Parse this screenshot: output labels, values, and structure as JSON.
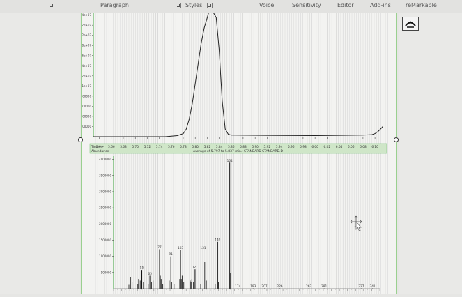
{
  "ribbon": {
    "paragraph_label": "Paragraph",
    "styles_label": "Styles",
    "tabs": [
      {
        "label": "Voice"
      },
      {
        "label": "Sensitivity"
      },
      {
        "label": "Editor"
      },
      {
        "label": "Add-ins"
      },
      {
        "label": "reMarkable"
      }
    ]
  },
  "chromatogram": {
    "y_ticks": [
      "2.4e+07",
      "2.2e+07",
      "2e+07",
      "1.8e+07",
      "1.6e+07",
      "1.4e+07",
      "1.2e+07",
      "1e+07",
      "8000000",
      "6000000",
      "4000000",
      "2000000"
    ],
    "time_label": "Time-->",
    "x_ticks": [
      "5.64",
      "5.66",
      "5.68",
      "5.70",
      "5.72",
      "5.74",
      "5.76",
      "5.78",
      "5.80",
      "5.82",
      "5.84",
      "5.86",
      "5.88",
      "5.90",
      "5.92",
      "5.94",
      "5.96",
      "5.98",
      "6.00",
      "6.02",
      "6.04",
      "6.06",
      "6.08",
      "6.10"
    ]
  },
  "spectrum": {
    "abundance_label": "Abundance",
    "caption": "Average of 5.797 to 5.837 min.: STANDARD STANDARD.D",
    "y_ticks": [
      "4000000",
      "3500000",
      "3000000",
      "2500000",
      "2000000",
      "1500000",
      "1000000",
      "500000"
    ],
    "peak_labels": [
      "164",
      "149",
      "131",
      "103",
      "91",
      "77",
      "121",
      "55",
      "65",
      "174",
      "193",
      "207",
      "226",
      "262",
      "281",
      "327",
      "341"
    ]
  },
  "chart_data": [
    {
      "type": "line",
      "title": "",
      "xlabel": "Time-->",
      "ylabel": "",
      "xlim": [
        5.63,
        6.115
      ],
      "ylim": [
        0,
        24500000
      ],
      "grid": false,
      "legend": "none",
      "series": [
        {
          "x": [
            5.63,
            5.75,
            5.77,
            5.78,
            5.785,
            5.79,
            5.795,
            5.8,
            5.805,
            5.81,
            5.815,
            5.82,
            5.8235,
            5.828,
            5.835,
            5.84,
            5.845,
            5.85,
            5.855,
            5.86,
            6.0,
            6.08,
            6.095,
            6.1,
            6.105,
            6.11,
            6.113
          ],
          "y": [
            0,
            0,
            200000,
            600000,
            1500000,
            3500000,
            6500000,
            10500000,
            14500000,
            18500000,
            21500000,
            23500000,
            25000000,
            25000000,
            23500000,
            17000000,
            7000000,
            1500000,
            500000,
            300000,
            200000,
            300000,
            400000,
            600000,
            1000000,
            1600000,
            2000000
          ]
        }
      ]
    },
    {
      "type": "bar",
      "title": "Average of 5.797 to 5.837 min.: STANDARD STANDARD.D",
      "xlabel": "",
      "ylabel": "Abundance",
      "xlim": [
        20,
        350
      ],
      "ylim": [
        0,
        4100000
      ],
      "grid": false,
      "legend": "none",
      "labeled_peaks": [
        {
          "mz": 55,
          "abundance": 580000
        },
        {
          "mz": 65,
          "abundance": 400000
        },
        {
          "mz": 77,
          "abundance": 1220000
        },
        {
          "mz": 91,
          "abundance": 1000000
        },
        {
          "mz": 103,
          "abundance": 1200000
        },
        {
          "mz": 121,
          "abundance": 600000
        },
        {
          "mz": 131,
          "abundance": 1200000
        },
        {
          "mz": 149,
          "abundance": 1450000
        },
        {
          "mz": 164,
          "abundance": 3900000
        },
        {
          "mz": 174,
          "abundance": 10000
        },
        {
          "mz": 193,
          "abundance": 10000
        },
        {
          "mz": 207,
          "abundance": 10000
        },
        {
          "mz": 226,
          "abundance": 10000
        },
        {
          "mz": 262,
          "abundance": 10000
        },
        {
          "mz": 281,
          "abundance": 10000
        },
        {
          "mz": 327,
          "abundance": 10000
        },
        {
          "mz": 341,
          "abundance": 10000
        }
      ],
      "minor_peaks": [
        {
          "mz": 39,
          "abundance": 120000
        },
        {
          "mz": 41,
          "abundance": 350000
        },
        {
          "mz": 43,
          "abundance": 200000
        },
        {
          "mz": 50,
          "abundance": 150000
        },
        {
          "mz": 51,
          "abundance": 300000
        },
        {
          "mz": 53,
          "abundance": 250000
        },
        {
          "mz": 57,
          "abundance": 200000
        },
        {
          "mz": 63,
          "abundance": 150000
        },
        {
          "mz": 67,
          "abundance": 200000
        },
        {
          "mz": 69,
          "abundance": 250000
        },
        {
          "mz": 74,
          "abundance": 120000
        },
        {
          "mz": 78,
          "abundance": 400000
        },
        {
          "mz": 79,
          "abundance": 300000
        },
        {
          "mz": 81,
          "abundance": 150000
        },
        {
          "mz": 89,
          "abundance": 250000
        },
        {
          "mz": 92,
          "abundance": 200000
        },
        {
          "mz": 95,
          "abundance": 150000
        },
        {
          "mz": 102,
          "abundance": 300000
        },
        {
          "mz": 104,
          "abundance": 300000
        },
        {
          "mz": 105,
          "abundance": 400000
        },
        {
          "mz": 107,
          "abundance": 200000
        },
        {
          "mz": 115,
          "abundance": 250000
        },
        {
          "mz": 116,
          "abundance": 200000
        },
        {
          "mz": 117,
          "abundance": 300000
        },
        {
          "mz": 119,
          "abundance": 200000
        },
        {
          "mz": 128,
          "abundance": 150000
        },
        {
          "mz": 133,
          "abundance": 820000
        },
        {
          "mz": 135,
          "abundance": 250000
        },
        {
          "mz": 146,
          "abundance": 150000
        },
        {
          "mz": 150,
          "abundance": 200000
        },
        {
          "mz": 163,
          "abundance": 300000
        },
        {
          "mz": 165,
          "abundance": 480000
        }
      ]
    }
  ]
}
